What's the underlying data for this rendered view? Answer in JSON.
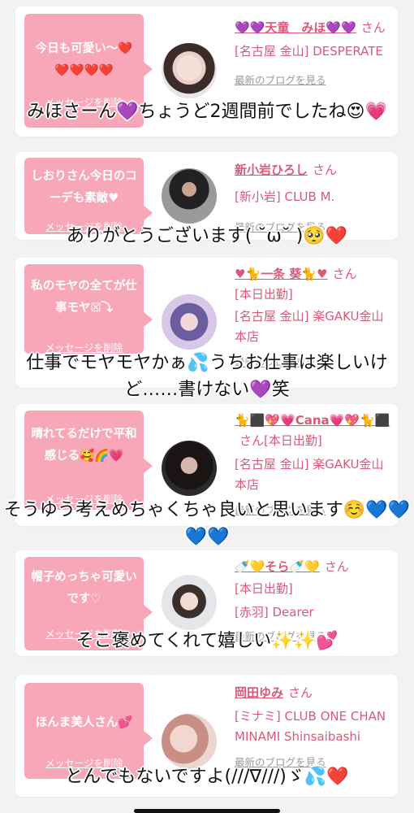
{
  "delete_label": "メッセージを削除",
  "blog_label": "最新のブログを見る",
  "san": "さん",
  "cards": [
    {
      "message": "今日も可愛い〜❤️❤️❤️❤️❤️",
      "name": "💜💜天童　みほ💜💜",
      "tag": "",
      "shop": "[名古屋 金山] DESPERATE",
      "reply": "みほさーん💜ちょうど2週間前でしたね😍💗"
    },
    {
      "message": "しおりさん今日のコーデも素敵♥",
      "name": "新小岩ひろし",
      "tag": "",
      "shop": "[新小岩] CLUB M.",
      "reply": "ありがとうございます( ˘ω˘ )🥺❤️"
    },
    {
      "message": "私のモヤの全てが仕事モヤ☒⤵",
      "name": "♥🐈一条 葵🐈♥",
      "tag": "[本日出勤]",
      "shop": "[名古屋 金山] 楽GAKU金山本店",
      "reply": "仕事でモヤモヤかぁ💦うちお仕事は楽しいけど……書けない💜笑"
    },
    {
      "message": "晴れてるだけで平和感じる🥰🌈💗",
      "name": "🐈⬛💖💗Cana💗💖🐈⬛",
      "tag": "[本日出勤]",
      "shop": "[名古屋 金山] 楽GAKU金山本店",
      "reply": "そうゆう考えめちゃくちゃ良いと思います☺️💙💙💙💙"
    },
    {
      "message": "帽子めっちゃ可愛いです♡",
      "name": "🍼💛そら🍼💛",
      "tag": "[本日出勤]",
      "shop": "[赤羽] Dearer",
      "reply": "そこ褒めてくれて嬉しい✨✨💕"
    },
    {
      "message": "ほんま美人さん💕",
      "name": "岡田ゆみ",
      "tag": "",
      "shop": "[ミナミ] CLUB ONE CHAN MINAMI Shinsaibashi",
      "reply": "とんでもないですよ(///∇///)ゞ💦❤️"
    }
  ]
}
